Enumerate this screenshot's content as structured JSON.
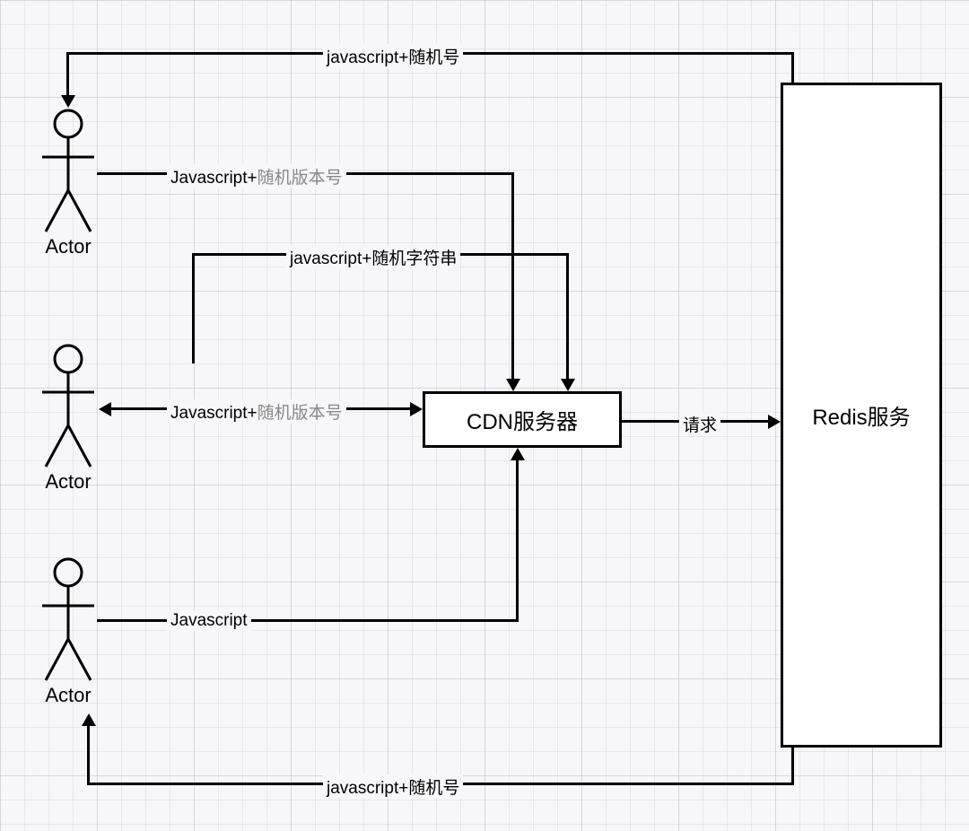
{
  "actors": [
    {
      "label": "Actor"
    },
    {
      "label": "Actor"
    },
    {
      "label": "Actor"
    }
  ],
  "nodes": {
    "cdn": "CDN服务器",
    "redis": "Redis服务"
  },
  "edges": {
    "actor1_out_prefix": "Javascript+",
    "actor1_out_suffix": "随机版本号",
    "actor2_out_prefix": "Javascript+",
    "actor2_out_suffix": "随机版本号",
    "actor3_out": "Javascript",
    "cdn_to_redis": "请求",
    "cdn_in_top": "javascript+随机字符串",
    "redis_to_actor1": "javascript+随机号",
    "redis_to_actor3": "javascript+随机号"
  }
}
